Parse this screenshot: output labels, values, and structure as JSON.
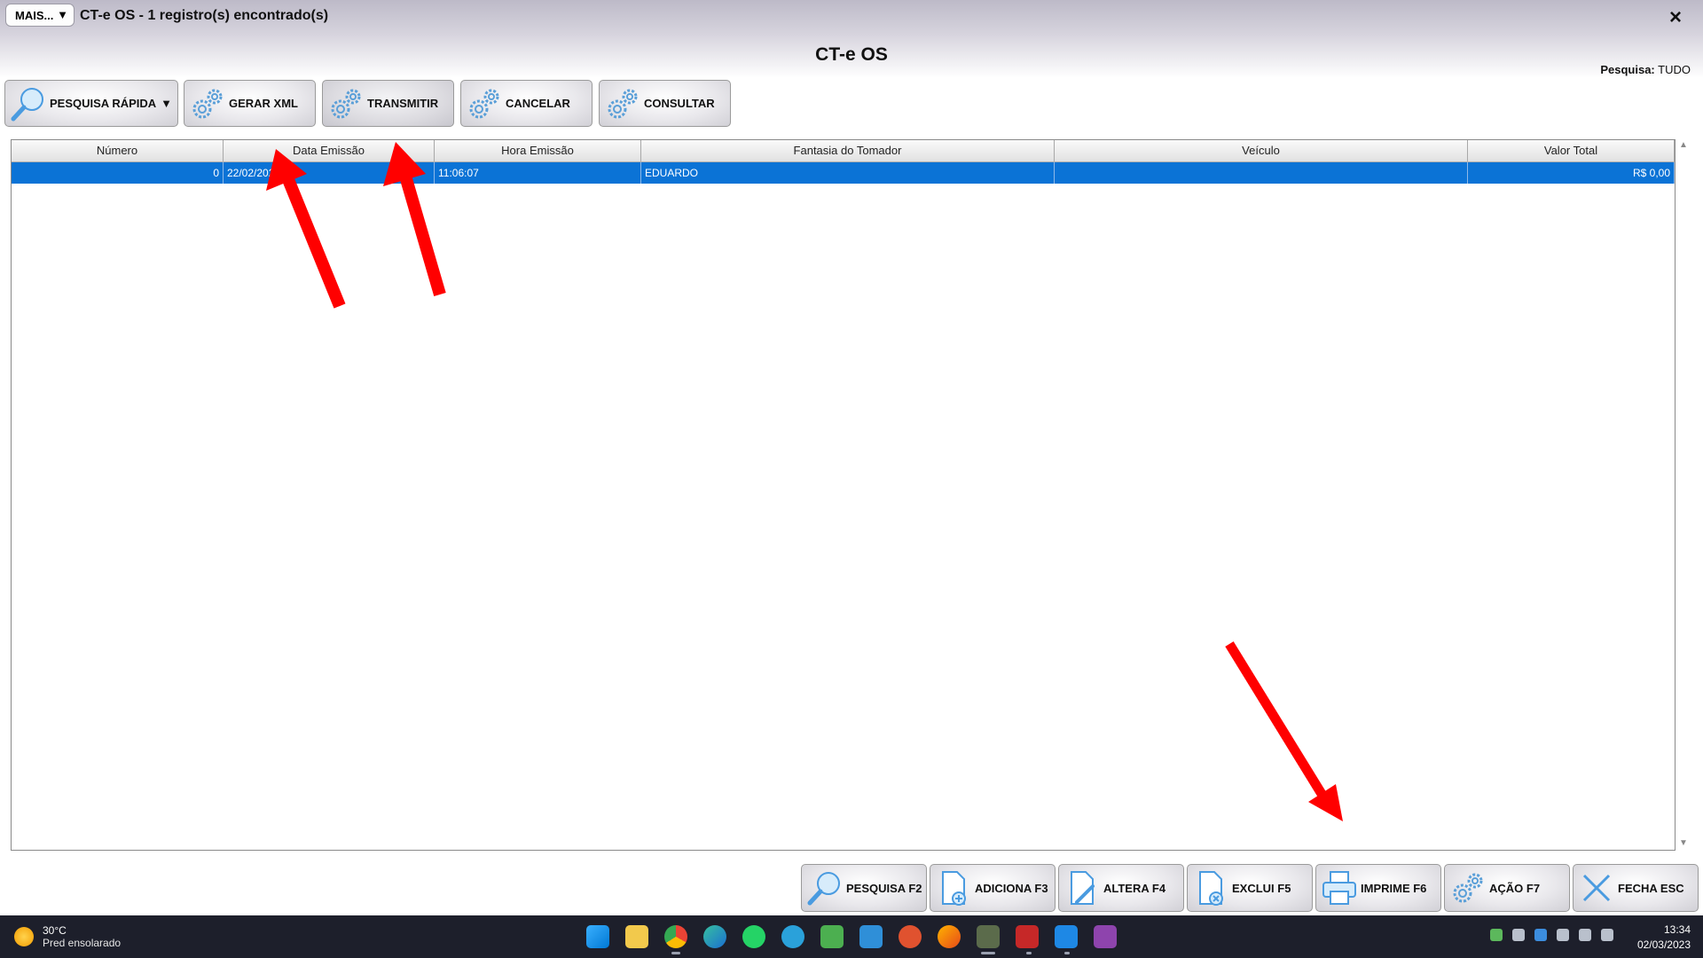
{
  "window": {
    "mais_label": "MAIS...",
    "mais_arrow": "▼",
    "title": "CT-e OS - 1 registro(s) encontrado(s)",
    "close_glyph": "×"
  },
  "page_title": "CT-e OS",
  "pesquisa": {
    "label": "Pesquisa:",
    "value": "TUDO"
  },
  "toolbar": [
    {
      "name": "pesquisa-rapida-button",
      "label": "PESQUISA RÁPIDA",
      "icon": "magnifier-icon"
    },
    {
      "name": "gerar-xml-button",
      "label": "GERAR XML",
      "icon": "gears-icon"
    },
    {
      "name": "transmitir-button",
      "label": "TRANSMITIR",
      "icon": "gears-icon"
    },
    {
      "name": "cancelar-button",
      "label": "CANCELAR",
      "icon": "gears-icon"
    },
    {
      "name": "consultar-button",
      "label": "CONSULTAR",
      "icon": "gears-icon"
    }
  ],
  "dropdown_arrow": "▼",
  "table": {
    "columns": [
      "Número",
      "Data Emissão",
      "Hora Emissão",
      "Fantasia do Tomador",
      "Veículo",
      "Valor Total"
    ],
    "rows": [
      {
        "numero": "0",
        "data": "22/02/2023",
        "hora": "11:06:07",
        "tomador": "EDUARDO",
        "veiculo": "",
        "valor": "R$ 0,00"
      }
    ]
  },
  "scroll": {
    "up": "▲",
    "down": "▼"
  },
  "bottom_buttons": [
    {
      "name": "pesquisa-button",
      "label": "PESQUISA F2",
      "icon": "magnifier-icon"
    },
    {
      "name": "adiciona-button",
      "label": "ADICIONA F3",
      "icon": "document-add-icon"
    },
    {
      "name": "altera-button",
      "label": "ALTERA F4",
      "icon": "document-edit-icon"
    },
    {
      "name": "exclui-button",
      "label": "EXCLUI F5",
      "icon": "document-delete-icon"
    },
    {
      "name": "imprime-button",
      "label": "IMPRIME F6",
      "icon": "printer-icon"
    },
    {
      "name": "acao-button",
      "label": "AÇÃO F7",
      "icon": "gears-icon"
    },
    {
      "name": "fecha-button",
      "label": "FECHA ESC",
      "icon": "close-icon"
    }
  ],
  "taskbar": {
    "weather_temp": "30°C",
    "weather_desc": "Pred ensolarado",
    "time": "13:34",
    "date": "02/03/2023",
    "apps": [
      "windows-start-icon",
      "file-explorer-icon",
      "chrome-icon",
      "edge-icon",
      "whatsapp-icon",
      "telegram-icon",
      "spreadsheet-icon",
      "remote-icon",
      "app-icon",
      "firefox-icon",
      "system-app-icon",
      "filezilla-icon",
      "notepad-icon",
      "clapper-icon"
    ]
  },
  "colors": {
    "selection": "#0b73d6",
    "annotation_arrow": "#ff0000"
  }
}
